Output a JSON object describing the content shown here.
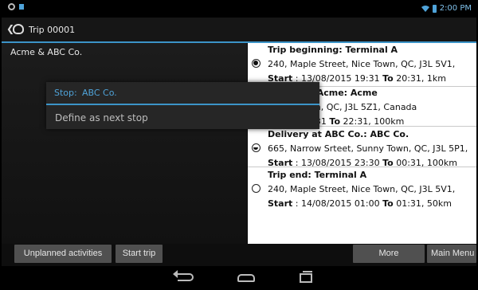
{
  "status_bar": {
    "time": "2:00 PM",
    "icons": [
      "notification-circle-icon",
      "flag-icon",
      "wifi-icon",
      "battery-icon"
    ]
  },
  "action_bar": {
    "title": "Trip 00001"
  },
  "left_pane": {
    "title": "Acme & ABC Co."
  },
  "popup": {
    "title_label": "Stop:",
    "title_value": "ABC Co.",
    "items": [
      {
        "label": "Define as next stop"
      }
    ]
  },
  "stops": [
    {
      "header": "Trip beginning:  Terminal A",
      "address": "240, Maple Street, Nice Town, QC, J3L 5V1,",
      "start_label": "Start",
      "start": " : 13/08/2015 19:31  ",
      "to_label": "To",
      "to": " 20:31, 1km",
      "radio": "checked"
    },
    {
      "header": "Pickup at Acme:  Acme",
      "address": "et, Big Town, QC, J3L 5Z1, Canada",
      "start_label": "",
      "start": "8/2015 21:31  ",
      "to_label": "To",
      "to": " 22:31, 100km",
      "radio": "none"
    },
    {
      "header": "Delivery at ABC Co.:  ABC Co.",
      "address": "665, Narrow Srteet, Sunny Town, QC, J3L 5P1,",
      "start_label": "Start",
      "start": " : 13/08/2015 23:30  ",
      "to_label": "To",
      "to": " 00:31, 100km",
      "radio": "half"
    },
    {
      "header": "Trip end:  Terminal A",
      "address": "240, Maple Street, Nice Town, QC, J3L 5V1,",
      "start_label": "Start",
      "start": " : 14/08/2015 01:00  ",
      "to_label": "To",
      "to": " 01:31, 50km",
      "radio": "empty"
    }
  ],
  "buttons": {
    "unplanned": "Unplanned activities",
    "start_trip": "Start trip",
    "more": "More",
    "main_menu": "Main Menu"
  },
  "colors": {
    "accent": "#3c94c8",
    "popup_text": "#4fa3d9",
    "button_bg": "#505050"
  }
}
